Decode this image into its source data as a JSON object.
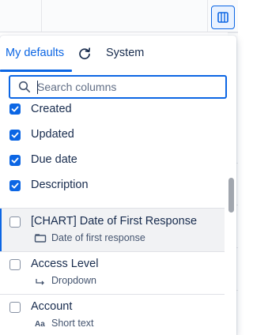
{
  "toolbar": {
    "columns_icon": "columns-icon"
  },
  "tabs": {
    "defaults_label": "My defaults",
    "system_label": "System",
    "refresh_icon": "refresh-icon"
  },
  "search": {
    "placeholder": "Search columns",
    "value": "",
    "icon": "search-icon"
  },
  "columns": [
    {
      "label": "Created",
      "checked": true
    },
    {
      "label": "Updated",
      "checked": true
    },
    {
      "label": "Due date",
      "checked": true
    },
    {
      "label": "Description",
      "checked": true
    },
    {
      "label": "[CHART] Date of First Response",
      "checked": false,
      "type_label": "Date of first response",
      "type_icon": "calendar-field-icon"
    },
    {
      "label": "Access Level",
      "checked": false,
      "type_label": "Dropdown",
      "type_icon": "dropdown-field-icon"
    },
    {
      "label": "Account",
      "checked": false,
      "type_label": "Short text",
      "type_icon": "text-field-icon"
    }
  ],
  "colors": {
    "accent": "#0c66e4",
    "text": "#172b4d",
    "subtext": "#44546f",
    "highlight_bg": "#f1f2f4"
  }
}
